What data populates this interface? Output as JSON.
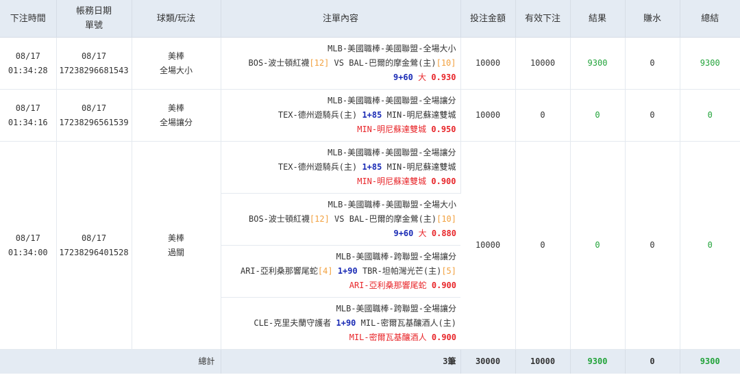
{
  "headers": {
    "time": "下注時間",
    "date_line1": "帳務日期",
    "date_line2": "單號",
    "game": "球類/玩法",
    "content": "注單內容",
    "amount": "投注金額",
    "valid": "有效下注",
    "result": "結果",
    "commission": "賺水",
    "total": "總結"
  },
  "bets": [
    {
      "date": "08/17",
      "time": "01:34:28",
      "acct_date": "08/17",
      "order_no": "17238296681543",
      "sport": "美棒",
      "play": "全場大小",
      "amount": "10000",
      "valid": "10000",
      "result": "9300",
      "commission": "0",
      "total": "9300",
      "legs": [
        {
          "league": "MLB-美國職棒-美國聯盟-全場大小",
          "home": "BOS-波士頓紅襪",
          "home_rank": "[12]",
          "vs": "VS",
          "hdp": "",
          "away": "BAL-巴爾的摩金鶯(主)",
          "away_rank": "[10]",
          "line": "9+60",
          "pick": "大",
          "odds": "0.930"
        }
      ]
    },
    {
      "date": "08/17",
      "time": "01:34:16",
      "acct_date": "08/17",
      "order_no": "17238296561539",
      "sport": "美棒",
      "play": "全場讓分",
      "amount": "10000",
      "valid": "0",
      "result": "0",
      "commission": "0",
      "total": "0",
      "legs": [
        {
          "league": "MLB-美國職棒-美國聯盟-全場讓分",
          "home": "TEX-德州遊騎兵(主)",
          "home_rank": "",
          "vs": "",
          "hdp": "1+85",
          "away": "MIN-明尼蘇達雙城",
          "away_rank": "",
          "line": "",
          "pick": "MIN-明尼蘇達雙城",
          "odds": "0.950"
        }
      ]
    },
    {
      "date": "08/17",
      "time": "01:34:00",
      "acct_date": "08/17",
      "order_no": "17238296401528",
      "sport": "美棒",
      "play": "過關",
      "amount": "10000",
      "valid": "0",
      "result": "0",
      "commission": "0",
      "total": "0",
      "legs": [
        {
          "league": "MLB-美國職棒-美國聯盟-全場讓分",
          "home": "TEX-德州遊騎兵(主)",
          "home_rank": "",
          "vs": "",
          "hdp": "1+85",
          "away": "MIN-明尼蘇達雙城",
          "away_rank": "",
          "line": "",
          "pick": "MIN-明尼蘇達雙城",
          "odds": "0.900"
        },
        {
          "league": "MLB-美國職棒-美國聯盟-全場大小",
          "home": "BOS-波士頓紅襪",
          "home_rank": "[12]",
          "vs": "VS",
          "hdp": "",
          "away": "BAL-巴爾的摩金鶯(主)",
          "away_rank": "[10]",
          "line": "9+60",
          "pick": "大",
          "odds": "0.880"
        },
        {
          "league": "MLB-美國職棒-跨聯盟-全場讓分",
          "home": "ARI-亞利桑那響尾蛇",
          "home_rank": "[4]",
          "vs": "",
          "hdp": "1+90",
          "away": "TBR-坦帕灣光芒(主)",
          "away_rank": "[5]",
          "line": "",
          "pick": "ARI-亞利桑那響尾蛇",
          "odds": "0.900"
        },
        {
          "league": "MLB-美國職棒-跨聯盟-全場讓分",
          "home": "CLE-克里夫蘭守護者",
          "home_rank": "",
          "vs": "",
          "hdp": "1+90",
          "away": "MIL-密爾瓦基釀酒人(主)",
          "away_rank": "",
          "line": "",
          "pick": "MIL-密爾瓦基釀酒人",
          "odds": "0.900"
        }
      ]
    }
  ],
  "summary": {
    "label": "總計",
    "count": "3筆",
    "amount": "30000",
    "valid": "10000",
    "result": "9300",
    "commission": "0",
    "total": "9300"
  },
  "colors": {
    "header_bg": "#e4ebf3",
    "win_green": "#22a33a",
    "handicap_blue": "#1a2bb5",
    "pick_red": "#e8262a",
    "rank_orange": "#f2a03d"
  }
}
